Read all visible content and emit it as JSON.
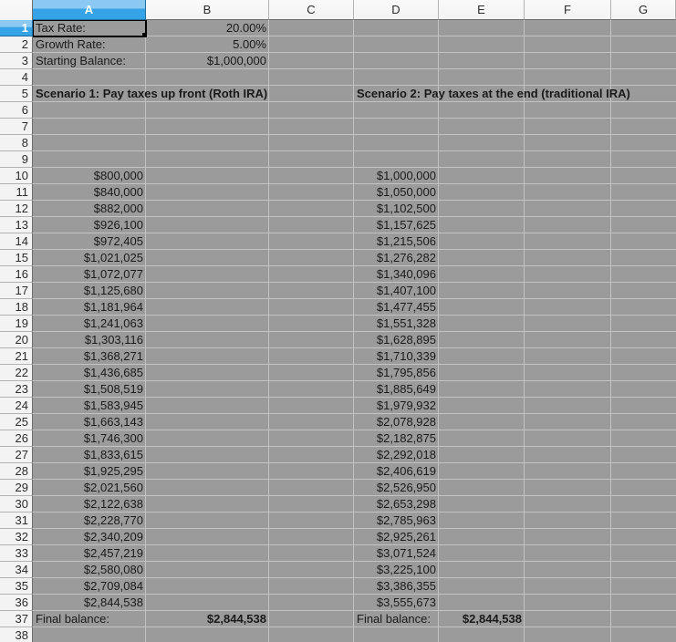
{
  "grid": {
    "column_headers": [
      "A",
      "B",
      "C",
      "D",
      "E",
      "F",
      "G"
    ],
    "row_count": 38,
    "first_data_row": 10,
    "selected_column": "A",
    "selected_row": 1,
    "selected_cell": "A1"
  },
  "parameters": {
    "tax_rate": {
      "label": "Tax Rate:",
      "value": "20.00%"
    },
    "growth_rate": {
      "label": "Growth Rate:",
      "value": "5.00%"
    },
    "starting_balance": {
      "label": "Starting Balance:",
      "value": "$1,000,000"
    }
  },
  "scenario1": {
    "title": "Scenario 1: Pay taxes up front (Roth IRA)",
    "values": [
      "$800,000",
      "$840,000",
      "$882,000",
      "$926,100",
      "$972,405",
      "$1,021,025",
      "$1,072,077",
      "$1,125,680",
      "$1,181,964",
      "$1,241,063",
      "$1,303,116",
      "$1,368,271",
      "$1,436,685",
      "$1,508,519",
      "$1,583,945",
      "$1,663,143",
      "$1,746,300",
      "$1,833,615",
      "$1,925,295",
      "$2,021,560",
      "$2,122,638",
      "$2,228,770",
      "$2,340,209",
      "$2,457,219",
      "$2,580,080",
      "$2,709,084",
      "$2,844,538"
    ],
    "final_label": "Final balance:",
    "final_value": "$2,844,538"
  },
  "scenario2": {
    "title": "Scenario 2: Pay taxes at the end (traditional IRA)",
    "values": [
      "$1,000,000",
      "$1,050,000",
      "$1,102,500",
      "$1,157,625",
      "$1,215,506",
      "$1,276,282",
      "$1,340,096",
      "$1,407,100",
      "$1,477,455",
      "$1,551,328",
      "$1,628,895",
      "$1,710,339",
      "$1,795,856",
      "$1,885,649",
      "$1,979,932",
      "$2,078,928",
      "$2,182,875",
      "$2,292,018",
      "$2,406,619",
      "$2,526,950",
      "$2,653,298",
      "$2,785,963",
      "$2,925,261",
      "$3,071,524",
      "$3,225,100",
      "$3,386,355",
      "$3,555,673"
    ],
    "final_label": "Final balance:",
    "final_value": "$2,844,538"
  },
  "colors": {
    "cell_bg": "#9b9b9b",
    "gridline": "#c3c3c3",
    "cell_text": "#1a1a1a",
    "header_bg": "#f3f3f3",
    "header_text": "#2b2b2b",
    "header_border": "#6e6e6e",
    "header_sep": "#b3b3b3",
    "selected_header_top": "#8bc9f2",
    "selected_header_bottom": "#36a3e7",
    "selection": "#000000"
  }
}
